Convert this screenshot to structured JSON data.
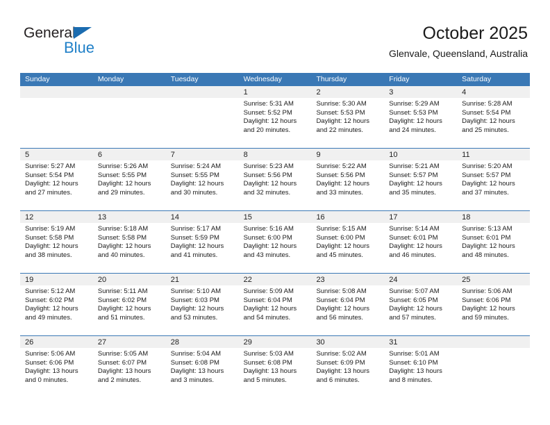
{
  "brand": {
    "name_top": "General",
    "name_bottom": "Blue",
    "triangle_color": "#1b6cb0",
    "blue_color": "#2080c8"
  },
  "header": {
    "month_title": "October 2025",
    "location": "Glenvale, Queensland, Australia",
    "accent_color": "#3a78b5",
    "daynum_band_color": "#f0f0f0"
  },
  "weekdays": [
    "Sunday",
    "Monday",
    "Tuesday",
    "Wednesday",
    "Thursday",
    "Friday",
    "Saturday"
  ],
  "weeks": [
    [
      {
        "day": "",
        "sunrise": "",
        "sunset": "",
        "daylight_1": "",
        "daylight_2": ""
      },
      {
        "day": "",
        "sunrise": "",
        "sunset": "",
        "daylight_1": "",
        "daylight_2": ""
      },
      {
        "day": "",
        "sunrise": "",
        "sunset": "",
        "daylight_1": "",
        "daylight_2": ""
      },
      {
        "day": "1",
        "sunrise": "Sunrise: 5:31 AM",
        "sunset": "Sunset: 5:52 PM",
        "daylight_1": "Daylight: 12 hours",
        "daylight_2": "and 20 minutes."
      },
      {
        "day": "2",
        "sunrise": "Sunrise: 5:30 AM",
        "sunset": "Sunset: 5:53 PM",
        "daylight_1": "Daylight: 12 hours",
        "daylight_2": "and 22 minutes."
      },
      {
        "day": "3",
        "sunrise": "Sunrise: 5:29 AM",
        "sunset": "Sunset: 5:53 PM",
        "daylight_1": "Daylight: 12 hours",
        "daylight_2": "and 24 minutes."
      },
      {
        "day": "4",
        "sunrise": "Sunrise: 5:28 AM",
        "sunset": "Sunset: 5:54 PM",
        "daylight_1": "Daylight: 12 hours",
        "daylight_2": "and 25 minutes."
      }
    ],
    [
      {
        "day": "5",
        "sunrise": "Sunrise: 5:27 AM",
        "sunset": "Sunset: 5:54 PM",
        "daylight_1": "Daylight: 12 hours",
        "daylight_2": "and 27 minutes."
      },
      {
        "day": "6",
        "sunrise": "Sunrise: 5:26 AM",
        "sunset": "Sunset: 5:55 PM",
        "daylight_1": "Daylight: 12 hours",
        "daylight_2": "and 29 minutes."
      },
      {
        "day": "7",
        "sunrise": "Sunrise: 5:24 AM",
        "sunset": "Sunset: 5:55 PM",
        "daylight_1": "Daylight: 12 hours",
        "daylight_2": "and 30 minutes."
      },
      {
        "day": "8",
        "sunrise": "Sunrise: 5:23 AM",
        "sunset": "Sunset: 5:56 PM",
        "daylight_1": "Daylight: 12 hours",
        "daylight_2": "and 32 minutes."
      },
      {
        "day": "9",
        "sunrise": "Sunrise: 5:22 AM",
        "sunset": "Sunset: 5:56 PM",
        "daylight_1": "Daylight: 12 hours",
        "daylight_2": "and 33 minutes."
      },
      {
        "day": "10",
        "sunrise": "Sunrise: 5:21 AM",
        "sunset": "Sunset: 5:57 PM",
        "daylight_1": "Daylight: 12 hours",
        "daylight_2": "and 35 minutes."
      },
      {
        "day": "11",
        "sunrise": "Sunrise: 5:20 AM",
        "sunset": "Sunset: 5:57 PM",
        "daylight_1": "Daylight: 12 hours",
        "daylight_2": "and 37 minutes."
      }
    ],
    [
      {
        "day": "12",
        "sunrise": "Sunrise: 5:19 AM",
        "sunset": "Sunset: 5:58 PM",
        "daylight_1": "Daylight: 12 hours",
        "daylight_2": "and 38 minutes."
      },
      {
        "day": "13",
        "sunrise": "Sunrise: 5:18 AM",
        "sunset": "Sunset: 5:58 PM",
        "daylight_1": "Daylight: 12 hours",
        "daylight_2": "and 40 minutes."
      },
      {
        "day": "14",
        "sunrise": "Sunrise: 5:17 AM",
        "sunset": "Sunset: 5:59 PM",
        "daylight_1": "Daylight: 12 hours",
        "daylight_2": "and 41 minutes."
      },
      {
        "day": "15",
        "sunrise": "Sunrise: 5:16 AM",
        "sunset": "Sunset: 6:00 PM",
        "daylight_1": "Daylight: 12 hours",
        "daylight_2": "and 43 minutes."
      },
      {
        "day": "16",
        "sunrise": "Sunrise: 5:15 AM",
        "sunset": "Sunset: 6:00 PM",
        "daylight_1": "Daylight: 12 hours",
        "daylight_2": "and 45 minutes."
      },
      {
        "day": "17",
        "sunrise": "Sunrise: 5:14 AM",
        "sunset": "Sunset: 6:01 PM",
        "daylight_1": "Daylight: 12 hours",
        "daylight_2": "and 46 minutes."
      },
      {
        "day": "18",
        "sunrise": "Sunrise: 5:13 AM",
        "sunset": "Sunset: 6:01 PM",
        "daylight_1": "Daylight: 12 hours",
        "daylight_2": "and 48 minutes."
      }
    ],
    [
      {
        "day": "19",
        "sunrise": "Sunrise: 5:12 AM",
        "sunset": "Sunset: 6:02 PM",
        "daylight_1": "Daylight: 12 hours",
        "daylight_2": "and 49 minutes."
      },
      {
        "day": "20",
        "sunrise": "Sunrise: 5:11 AM",
        "sunset": "Sunset: 6:02 PM",
        "daylight_1": "Daylight: 12 hours",
        "daylight_2": "and 51 minutes."
      },
      {
        "day": "21",
        "sunrise": "Sunrise: 5:10 AM",
        "sunset": "Sunset: 6:03 PM",
        "daylight_1": "Daylight: 12 hours",
        "daylight_2": "and 53 minutes."
      },
      {
        "day": "22",
        "sunrise": "Sunrise: 5:09 AM",
        "sunset": "Sunset: 6:04 PM",
        "daylight_1": "Daylight: 12 hours",
        "daylight_2": "and 54 minutes."
      },
      {
        "day": "23",
        "sunrise": "Sunrise: 5:08 AM",
        "sunset": "Sunset: 6:04 PM",
        "daylight_1": "Daylight: 12 hours",
        "daylight_2": "and 56 minutes."
      },
      {
        "day": "24",
        "sunrise": "Sunrise: 5:07 AM",
        "sunset": "Sunset: 6:05 PM",
        "daylight_1": "Daylight: 12 hours",
        "daylight_2": "and 57 minutes."
      },
      {
        "day": "25",
        "sunrise": "Sunrise: 5:06 AM",
        "sunset": "Sunset: 6:06 PM",
        "daylight_1": "Daylight: 12 hours",
        "daylight_2": "and 59 minutes."
      }
    ],
    [
      {
        "day": "26",
        "sunrise": "Sunrise: 5:06 AM",
        "sunset": "Sunset: 6:06 PM",
        "daylight_1": "Daylight: 13 hours",
        "daylight_2": "and 0 minutes."
      },
      {
        "day": "27",
        "sunrise": "Sunrise: 5:05 AM",
        "sunset": "Sunset: 6:07 PM",
        "daylight_1": "Daylight: 13 hours",
        "daylight_2": "and 2 minutes."
      },
      {
        "day": "28",
        "sunrise": "Sunrise: 5:04 AM",
        "sunset": "Sunset: 6:08 PM",
        "daylight_1": "Daylight: 13 hours",
        "daylight_2": "and 3 minutes."
      },
      {
        "day": "29",
        "sunrise": "Sunrise: 5:03 AM",
        "sunset": "Sunset: 6:08 PM",
        "daylight_1": "Daylight: 13 hours",
        "daylight_2": "and 5 minutes."
      },
      {
        "day": "30",
        "sunrise": "Sunrise: 5:02 AM",
        "sunset": "Sunset: 6:09 PM",
        "daylight_1": "Daylight: 13 hours",
        "daylight_2": "and 6 minutes."
      },
      {
        "day": "31",
        "sunrise": "Sunrise: 5:01 AM",
        "sunset": "Sunset: 6:10 PM",
        "daylight_1": "Daylight: 13 hours",
        "daylight_2": "and 8 minutes."
      },
      {
        "day": "",
        "sunrise": "",
        "sunset": "",
        "daylight_1": "",
        "daylight_2": ""
      }
    ]
  ]
}
